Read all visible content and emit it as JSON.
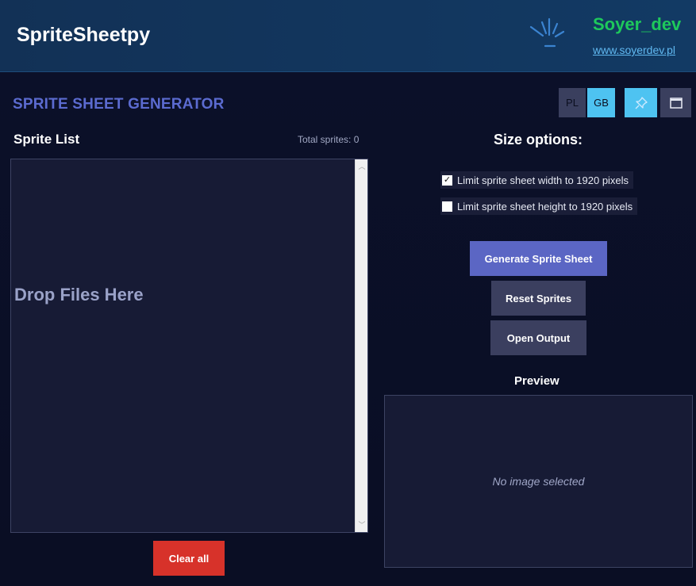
{
  "header": {
    "app_title": "SpriteSheetpy",
    "brand_name": "Soyer_dev",
    "brand_link": "www.soyerdev.pl"
  },
  "toolbar": {
    "lang_pl": "PL",
    "lang_gb": "GB",
    "pin_icon": "pin-icon",
    "window_icon": "window-icon"
  },
  "section_title": "SPRITE SHEET GENERATOR",
  "sprite_list": {
    "title": "Sprite List",
    "total_label": "Total sprites: 0",
    "drop_text": "Drop Files Here",
    "clear_label": "Clear all"
  },
  "size_options": {
    "title": "Size options:",
    "limit_width": {
      "label": "Limit sprite sheet width to 1920 pixels",
      "checked": true
    },
    "limit_height": {
      "label": "Limit sprite sheet height to 1920 pixels",
      "checked": false
    }
  },
  "actions": {
    "generate": "Generate Sprite Sheet",
    "reset": "Reset Sprites",
    "open_output": "Open Output"
  },
  "preview": {
    "title": "Preview",
    "empty_text": "No image selected"
  },
  "colors": {
    "accent_blue": "#4ec3f1",
    "brand_green": "#1ec95b",
    "title_purple": "#5b6bd0",
    "danger_red": "#d7322a",
    "primary_button": "#5b66c4"
  }
}
